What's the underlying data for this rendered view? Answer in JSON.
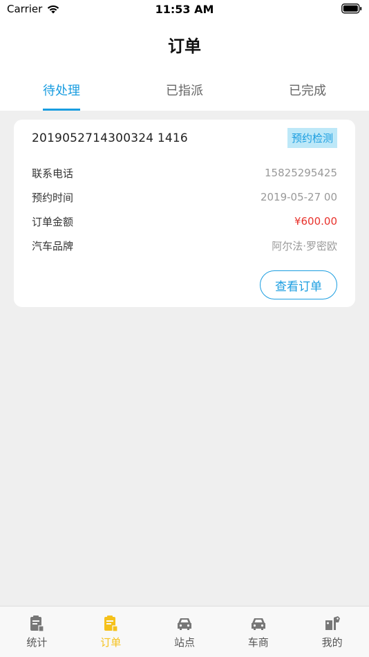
{
  "status": {
    "carrier": "Carrier",
    "time": "11:53 AM"
  },
  "nav": {
    "title": "订单"
  },
  "tabs": [
    {
      "label": "待处理",
      "active": true
    },
    {
      "label": "已指派",
      "active": false
    },
    {
      "label": "已完成",
      "active": false
    }
  ],
  "order": {
    "number": "2019052714300324 1416",
    "badge": "预约检测",
    "rows": [
      {
        "label": "联系电话",
        "value": "15825295425"
      },
      {
        "label": "预约时间",
        "value": "2019-05-27 00"
      },
      {
        "label": "订单金额",
        "value": "¥600.00"
      },
      {
        "label": "汽车品牌",
        "value": "阿尔法·罗密欧"
      }
    ],
    "view_button": "查看订单"
  },
  "bottom_nav": [
    {
      "label": "统计",
      "icon": "clipboard-icon",
      "active": false
    },
    {
      "label": "订单",
      "icon": "clipboard-icon",
      "active": true
    },
    {
      "label": "站点",
      "icon": "car-icon",
      "active": false
    },
    {
      "label": "车商",
      "icon": "car-icon",
      "active": false
    },
    {
      "label": "我的",
      "icon": "tools-icon",
      "active": false
    }
  ],
  "colors": {
    "accent": "#1a9de0",
    "active_tab": "#f5c11b",
    "price": "#e8322c"
  }
}
